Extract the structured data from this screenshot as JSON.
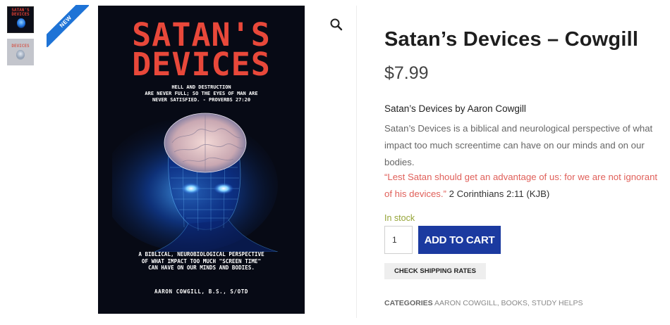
{
  "gallery": {
    "thumb1_alt_title": "SATAN'S DEVICES",
    "thumb2_alt_title": "DEVICES",
    "new_badge": "NEW"
  },
  "cover": {
    "title_line1": "SATAN'S",
    "title_line2": "DEVICES",
    "verse_line1": "HELL AND DESTRUCTION",
    "verse_line2": "ARE NEVER FULL; SO THE EYES OF MAN ARE",
    "verse_line3": "NEVER SATISFIED. - PROVERBS 27:20",
    "desc_line1": "A BIBLICAL, NEUROBIOLOGICAL PERSPECTIVE",
    "desc_line2": "OF WHAT IMPACT TOO MUCH \"SCREEN TIME\"",
    "desc_line3": "CAN HAVE ON OUR MINDS AND BODIES.",
    "author": "AARON COWGILL, B.S., S/OTD"
  },
  "product": {
    "title": "Satan’s Devices – Cowgill",
    "price": "$7.99",
    "byline": "Satan’s Devices by Aaron Cowgill",
    "description": "Satan’s Devices is a biblical and neurological perspective of what impact too much screentime can have on our minds and on our bodies.",
    "quote": "“Lest Satan should get an advantage of us: for we are not ignorant of his devices.”",
    "quote_ref": " 2 Corinthians 2:11 (KJB)",
    "stock": "In stock",
    "quantity": "1",
    "add_to_cart": "ADD TO CART",
    "shipping": "CHECK SHIPPING RATES",
    "categories_label": "CATEGORIES",
    "categories": [
      "AARON COWGILL",
      "BOOKS",
      "STUDY HELPS"
    ]
  },
  "colors": {
    "accent_blue": "#1b3aa0",
    "ribbon_blue": "#1e73d6",
    "stock_green": "#95a437",
    "quote_red": "#e0605a",
    "cover_red": "#e8483a"
  },
  "icons": [
    "search-icon"
  ]
}
